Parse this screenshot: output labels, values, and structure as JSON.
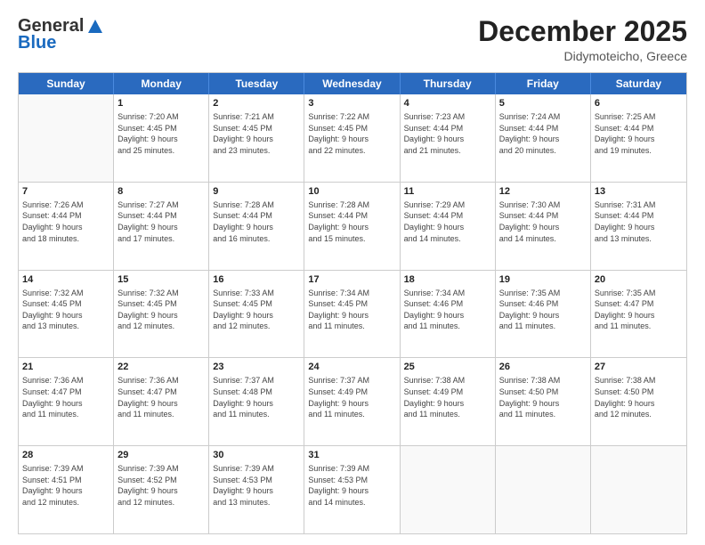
{
  "header": {
    "logo_general": "General",
    "logo_blue": "Blue",
    "month_title": "December 2025",
    "location": "Didymoteicho, Greece"
  },
  "weekdays": [
    "Sunday",
    "Monday",
    "Tuesday",
    "Wednesday",
    "Thursday",
    "Friday",
    "Saturday"
  ],
  "rows": [
    [
      {
        "day": "",
        "info": ""
      },
      {
        "day": "1",
        "info": "Sunrise: 7:20 AM\nSunset: 4:45 PM\nDaylight: 9 hours\nand 25 minutes."
      },
      {
        "day": "2",
        "info": "Sunrise: 7:21 AM\nSunset: 4:45 PM\nDaylight: 9 hours\nand 23 minutes."
      },
      {
        "day": "3",
        "info": "Sunrise: 7:22 AM\nSunset: 4:45 PM\nDaylight: 9 hours\nand 22 minutes."
      },
      {
        "day": "4",
        "info": "Sunrise: 7:23 AM\nSunset: 4:44 PM\nDaylight: 9 hours\nand 21 minutes."
      },
      {
        "day": "5",
        "info": "Sunrise: 7:24 AM\nSunset: 4:44 PM\nDaylight: 9 hours\nand 20 minutes."
      },
      {
        "day": "6",
        "info": "Sunrise: 7:25 AM\nSunset: 4:44 PM\nDaylight: 9 hours\nand 19 minutes."
      }
    ],
    [
      {
        "day": "7",
        "info": "Sunrise: 7:26 AM\nSunset: 4:44 PM\nDaylight: 9 hours\nand 18 minutes."
      },
      {
        "day": "8",
        "info": "Sunrise: 7:27 AM\nSunset: 4:44 PM\nDaylight: 9 hours\nand 17 minutes."
      },
      {
        "day": "9",
        "info": "Sunrise: 7:28 AM\nSunset: 4:44 PM\nDaylight: 9 hours\nand 16 minutes."
      },
      {
        "day": "10",
        "info": "Sunrise: 7:28 AM\nSunset: 4:44 PM\nDaylight: 9 hours\nand 15 minutes."
      },
      {
        "day": "11",
        "info": "Sunrise: 7:29 AM\nSunset: 4:44 PM\nDaylight: 9 hours\nand 14 minutes."
      },
      {
        "day": "12",
        "info": "Sunrise: 7:30 AM\nSunset: 4:44 PM\nDaylight: 9 hours\nand 14 minutes."
      },
      {
        "day": "13",
        "info": "Sunrise: 7:31 AM\nSunset: 4:44 PM\nDaylight: 9 hours\nand 13 minutes."
      }
    ],
    [
      {
        "day": "14",
        "info": "Sunrise: 7:32 AM\nSunset: 4:45 PM\nDaylight: 9 hours\nand 13 minutes."
      },
      {
        "day": "15",
        "info": "Sunrise: 7:32 AM\nSunset: 4:45 PM\nDaylight: 9 hours\nand 12 minutes."
      },
      {
        "day": "16",
        "info": "Sunrise: 7:33 AM\nSunset: 4:45 PM\nDaylight: 9 hours\nand 12 minutes."
      },
      {
        "day": "17",
        "info": "Sunrise: 7:34 AM\nSunset: 4:45 PM\nDaylight: 9 hours\nand 11 minutes."
      },
      {
        "day": "18",
        "info": "Sunrise: 7:34 AM\nSunset: 4:46 PM\nDaylight: 9 hours\nand 11 minutes."
      },
      {
        "day": "19",
        "info": "Sunrise: 7:35 AM\nSunset: 4:46 PM\nDaylight: 9 hours\nand 11 minutes."
      },
      {
        "day": "20",
        "info": "Sunrise: 7:35 AM\nSunset: 4:47 PM\nDaylight: 9 hours\nand 11 minutes."
      }
    ],
    [
      {
        "day": "21",
        "info": "Sunrise: 7:36 AM\nSunset: 4:47 PM\nDaylight: 9 hours\nand 11 minutes."
      },
      {
        "day": "22",
        "info": "Sunrise: 7:36 AM\nSunset: 4:47 PM\nDaylight: 9 hours\nand 11 minutes."
      },
      {
        "day": "23",
        "info": "Sunrise: 7:37 AM\nSunset: 4:48 PM\nDaylight: 9 hours\nand 11 minutes."
      },
      {
        "day": "24",
        "info": "Sunrise: 7:37 AM\nSunset: 4:49 PM\nDaylight: 9 hours\nand 11 minutes."
      },
      {
        "day": "25",
        "info": "Sunrise: 7:38 AM\nSunset: 4:49 PM\nDaylight: 9 hours\nand 11 minutes."
      },
      {
        "day": "26",
        "info": "Sunrise: 7:38 AM\nSunset: 4:50 PM\nDaylight: 9 hours\nand 11 minutes."
      },
      {
        "day": "27",
        "info": "Sunrise: 7:38 AM\nSunset: 4:50 PM\nDaylight: 9 hours\nand 12 minutes."
      }
    ],
    [
      {
        "day": "28",
        "info": "Sunrise: 7:39 AM\nSunset: 4:51 PM\nDaylight: 9 hours\nand 12 minutes."
      },
      {
        "day": "29",
        "info": "Sunrise: 7:39 AM\nSunset: 4:52 PM\nDaylight: 9 hours\nand 12 minutes."
      },
      {
        "day": "30",
        "info": "Sunrise: 7:39 AM\nSunset: 4:53 PM\nDaylight: 9 hours\nand 13 minutes."
      },
      {
        "day": "31",
        "info": "Sunrise: 7:39 AM\nSunset: 4:53 PM\nDaylight: 9 hours\nand 14 minutes."
      },
      {
        "day": "",
        "info": ""
      },
      {
        "day": "",
        "info": ""
      },
      {
        "day": "",
        "info": ""
      }
    ]
  ]
}
